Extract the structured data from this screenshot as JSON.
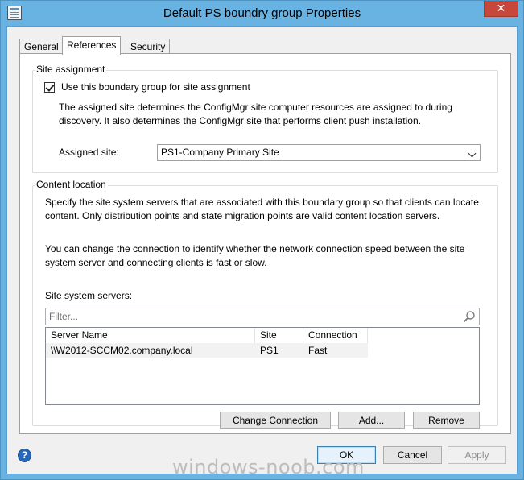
{
  "window": {
    "title": "Default PS boundry group Properties",
    "close_glyph": "✕"
  },
  "tabs": [
    {
      "label": "General"
    },
    {
      "label": "References"
    },
    {
      "label": "Security"
    }
  ],
  "site_assignment": {
    "group_label": "Site assignment",
    "checkbox_label": "Use this boundary group for site assignment",
    "checked": true,
    "description": "The assigned site determines the ConfigMgr site computer resources are assigned to during discovery. It also determines the ConfigMgr site that performs client push installation.",
    "assigned_site_label": "Assigned site:",
    "assigned_site_value": "PS1-Company Primary Site"
  },
  "content_location": {
    "group_label": "Content location",
    "description1": "Specify the site system servers that are associated with this boundary group so that clients can locate content. Only distribution points and state migration points are valid content location servers.",
    "description2": "You can change the connection to identify whether the network connection speed between the site system server and connecting clients is fast or slow.",
    "servers_label": "Site system servers:",
    "filter_placeholder": "Filter...",
    "columns": [
      "Server Name",
      "Site",
      "Connection"
    ],
    "rows": [
      {
        "server": "\\\\W2012-SCCM02.company.local",
        "site": "PS1",
        "connection": "Fast"
      }
    ],
    "buttons": {
      "change_connection": "Change Connection",
      "add": "Add...",
      "remove": "Remove"
    }
  },
  "footer": {
    "ok": "OK",
    "cancel": "Cancel",
    "apply": "Apply",
    "help": "?"
  },
  "watermark": "windows-noob.com",
  "colors": {
    "title_bar": "#69b3e2",
    "close": "#c7473b",
    "help": "#2868b8"
  }
}
